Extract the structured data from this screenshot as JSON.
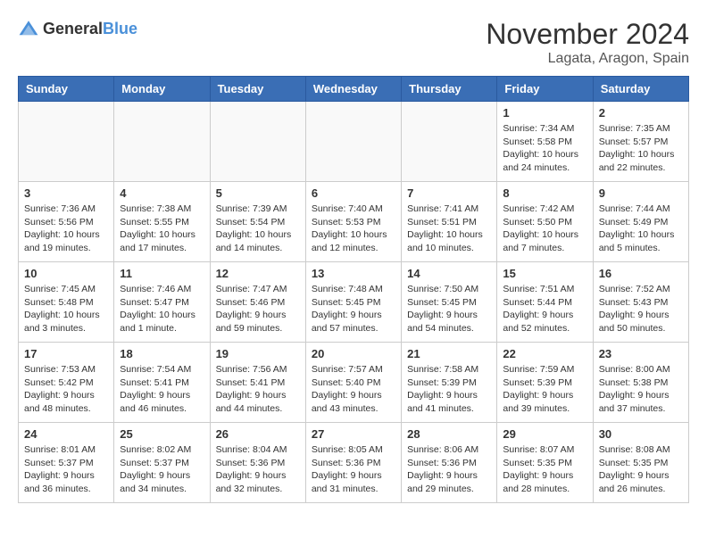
{
  "header": {
    "logo_general": "General",
    "logo_blue": "Blue",
    "month_title": "November 2024",
    "location": "Lagata, Aragon, Spain"
  },
  "weekdays": [
    "Sunday",
    "Monday",
    "Tuesday",
    "Wednesday",
    "Thursday",
    "Friday",
    "Saturday"
  ],
  "weeks": [
    [
      {
        "day": "",
        "info": ""
      },
      {
        "day": "",
        "info": ""
      },
      {
        "day": "",
        "info": ""
      },
      {
        "day": "",
        "info": ""
      },
      {
        "day": "",
        "info": ""
      },
      {
        "day": "1",
        "info": "Sunrise: 7:34 AM\nSunset: 5:58 PM\nDaylight: 10 hours and 24 minutes."
      },
      {
        "day": "2",
        "info": "Sunrise: 7:35 AM\nSunset: 5:57 PM\nDaylight: 10 hours and 22 minutes."
      }
    ],
    [
      {
        "day": "3",
        "info": "Sunrise: 7:36 AM\nSunset: 5:56 PM\nDaylight: 10 hours and 19 minutes."
      },
      {
        "day": "4",
        "info": "Sunrise: 7:38 AM\nSunset: 5:55 PM\nDaylight: 10 hours and 17 minutes."
      },
      {
        "day": "5",
        "info": "Sunrise: 7:39 AM\nSunset: 5:54 PM\nDaylight: 10 hours and 14 minutes."
      },
      {
        "day": "6",
        "info": "Sunrise: 7:40 AM\nSunset: 5:53 PM\nDaylight: 10 hours and 12 minutes."
      },
      {
        "day": "7",
        "info": "Sunrise: 7:41 AM\nSunset: 5:51 PM\nDaylight: 10 hours and 10 minutes."
      },
      {
        "day": "8",
        "info": "Sunrise: 7:42 AM\nSunset: 5:50 PM\nDaylight: 10 hours and 7 minutes."
      },
      {
        "day": "9",
        "info": "Sunrise: 7:44 AM\nSunset: 5:49 PM\nDaylight: 10 hours and 5 minutes."
      }
    ],
    [
      {
        "day": "10",
        "info": "Sunrise: 7:45 AM\nSunset: 5:48 PM\nDaylight: 10 hours and 3 minutes."
      },
      {
        "day": "11",
        "info": "Sunrise: 7:46 AM\nSunset: 5:47 PM\nDaylight: 10 hours and 1 minute."
      },
      {
        "day": "12",
        "info": "Sunrise: 7:47 AM\nSunset: 5:46 PM\nDaylight: 9 hours and 59 minutes."
      },
      {
        "day": "13",
        "info": "Sunrise: 7:48 AM\nSunset: 5:45 PM\nDaylight: 9 hours and 57 minutes."
      },
      {
        "day": "14",
        "info": "Sunrise: 7:50 AM\nSunset: 5:45 PM\nDaylight: 9 hours and 54 minutes."
      },
      {
        "day": "15",
        "info": "Sunrise: 7:51 AM\nSunset: 5:44 PM\nDaylight: 9 hours and 52 minutes."
      },
      {
        "day": "16",
        "info": "Sunrise: 7:52 AM\nSunset: 5:43 PM\nDaylight: 9 hours and 50 minutes."
      }
    ],
    [
      {
        "day": "17",
        "info": "Sunrise: 7:53 AM\nSunset: 5:42 PM\nDaylight: 9 hours and 48 minutes."
      },
      {
        "day": "18",
        "info": "Sunrise: 7:54 AM\nSunset: 5:41 PM\nDaylight: 9 hours and 46 minutes."
      },
      {
        "day": "19",
        "info": "Sunrise: 7:56 AM\nSunset: 5:41 PM\nDaylight: 9 hours and 44 minutes."
      },
      {
        "day": "20",
        "info": "Sunrise: 7:57 AM\nSunset: 5:40 PM\nDaylight: 9 hours and 43 minutes."
      },
      {
        "day": "21",
        "info": "Sunrise: 7:58 AM\nSunset: 5:39 PM\nDaylight: 9 hours and 41 minutes."
      },
      {
        "day": "22",
        "info": "Sunrise: 7:59 AM\nSunset: 5:39 PM\nDaylight: 9 hours and 39 minutes."
      },
      {
        "day": "23",
        "info": "Sunrise: 8:00 AM\nSunset: 5:38 PM\nDaylight: 9 hours and 37 minutes."
      }
    ],
    [
      {
        "day": "24",
        "info": "Sunrise: 8:01 AM\nSunset: 5:37 PM\nDaylight: 9 hours and 36 minutes."
      },
      {
        "day": "25",
        "info": "Sunrise: 8:02 AM\nSunset: 5:37 PM\nDaylight: 9 hours and 34 minutes."
      },
      {
        "day": "26",
        "info": "Sunrise: 8:04 AM\nSunset: 5:36 PM\nDaylight: 9 hours and 32 minutes."
      },
      {
        "day": "27",
        "info": "Sunrise: 8:05 AM\nSunset: 5:36 PM\nDaylight: 9 hours and 31 minutes."
      },
      {
        "day": "28",
        "info": "Sunrise: 8:06 AM\nSunset: 5:36 PM\nDaylight: 9 hours and 29 minutes."
      },
      {
        "day": "29",
        "info": "Sunrise: 8:07 AM\nSunset: 5:35 PM\nDaylight: 9 hours and 28 minutes."
      },
      {
        "day": "30",
        "info": "Sunrise: 8:08 AM\nSunset: 5:35 PM\nDaylight: 9 hours and 26 minutes."
      }
    ]
  ]
}
